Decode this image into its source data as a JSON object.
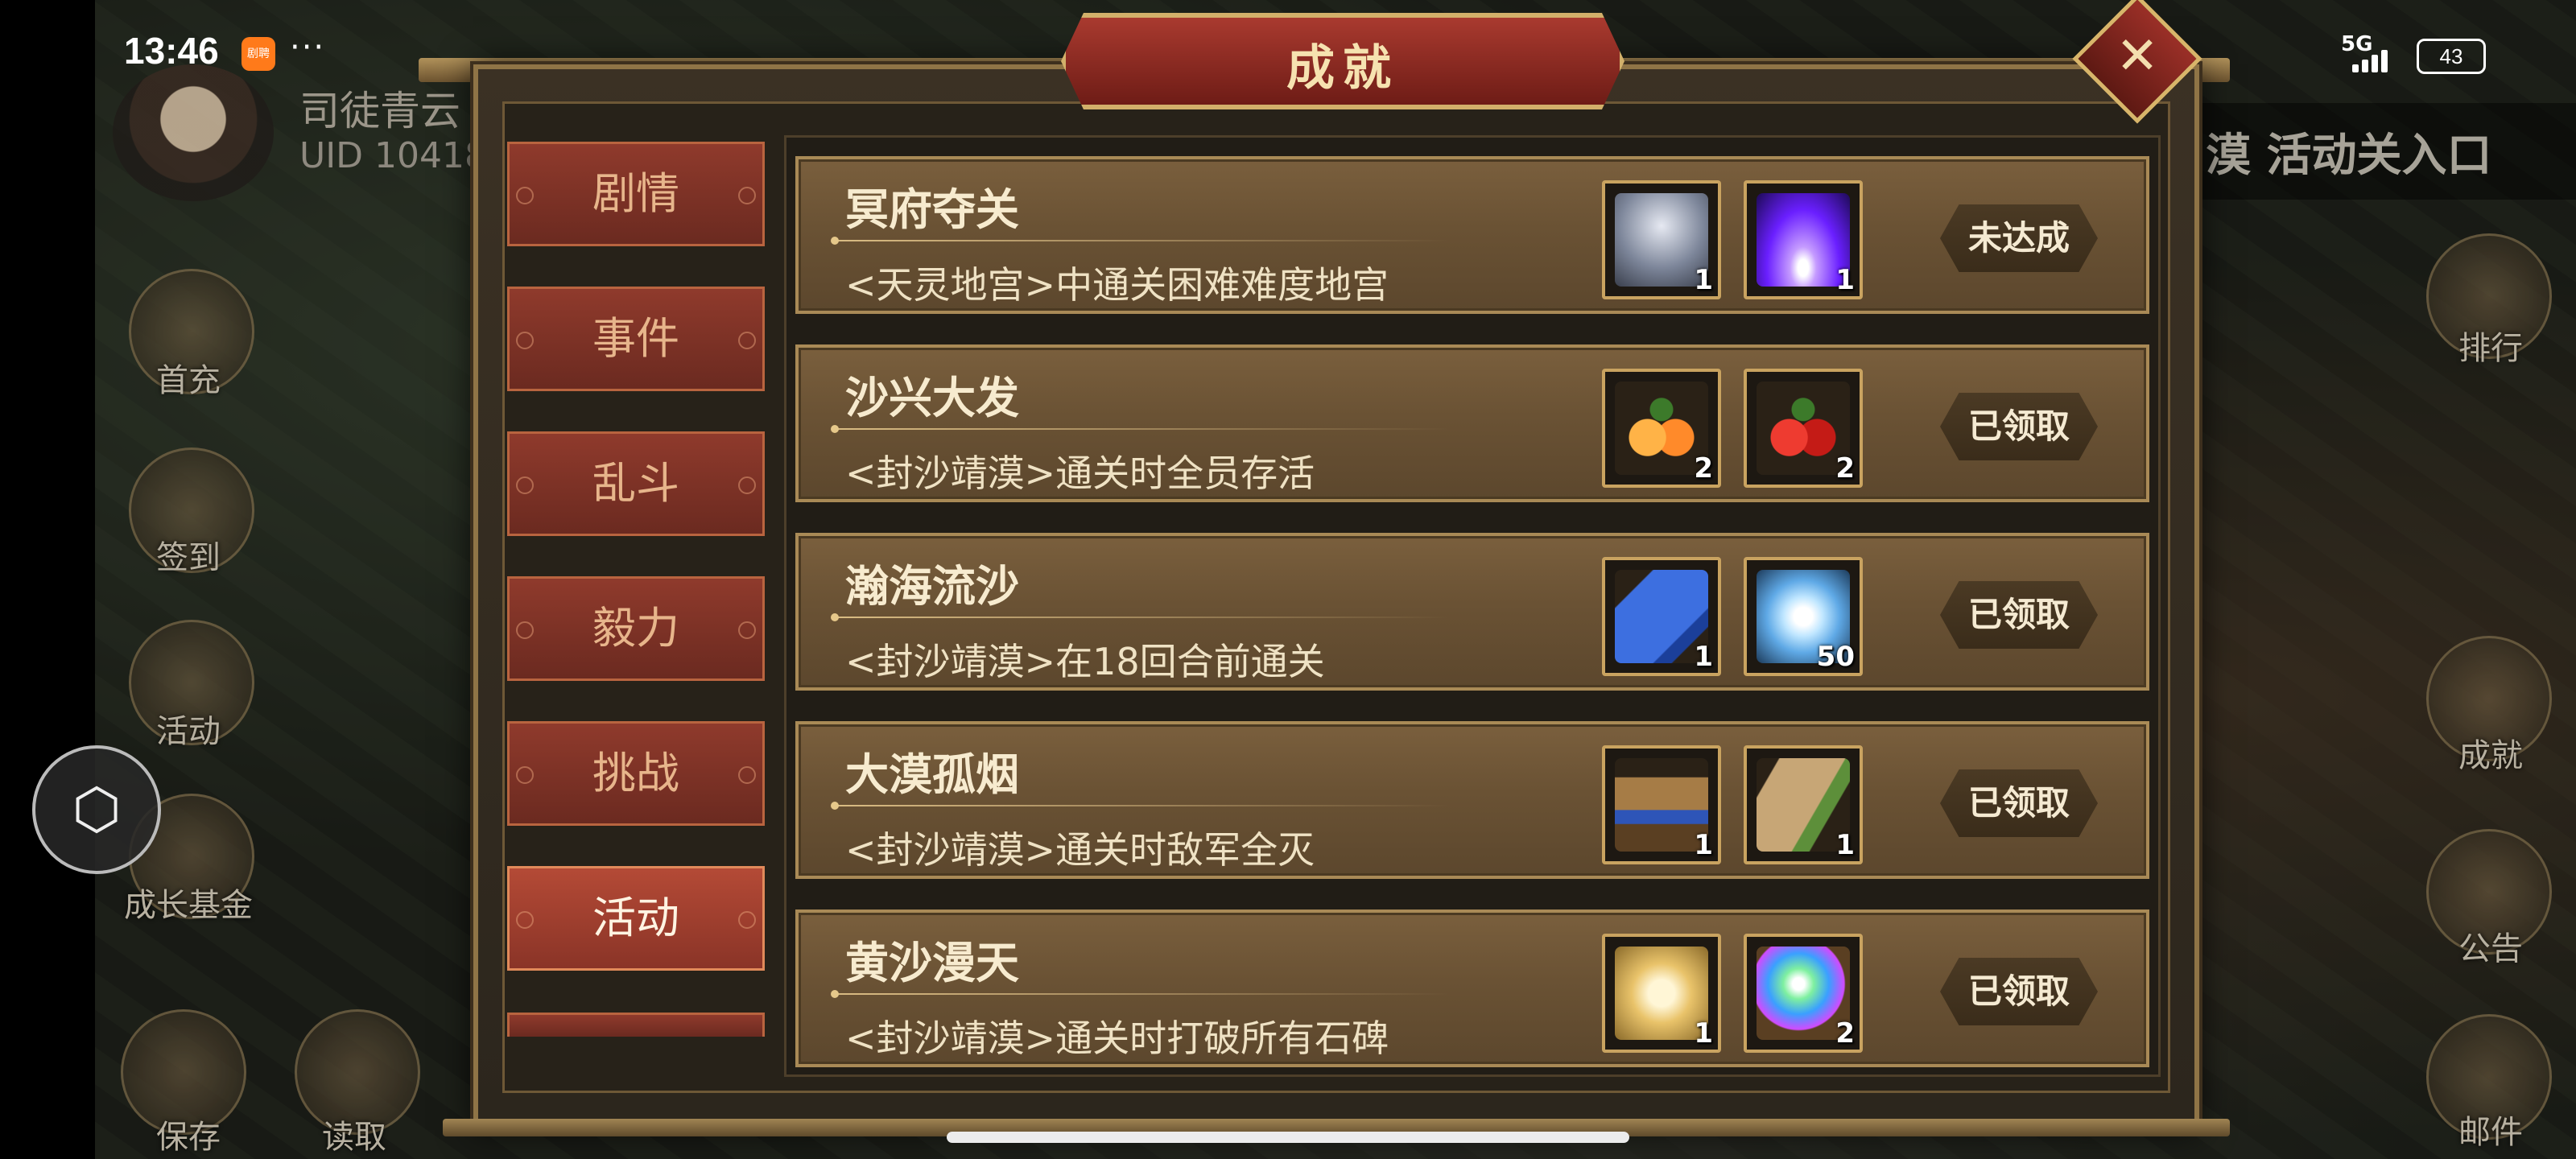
{
  "status_bar": {
    "time": "13:46",
    "app_badge": "剧聘",
    "more": "···",
    "network": "5G",
    "battery": "43"
  },
  "player": {
    "name": "司徒青云",
    "uid": "UID  10418"
  },
  "side_menu_left": [
    {
      "label": "首充",
      "icon": "gift-icon"
    },
    {
      "label": "签到",
      "icon": "scroll-icon"
    },
    {
      "label": "活动",
      "icon": "bag-icon"
    },
    {
      "label": "成长基金",
      "icon": "flower-icon"
    },
    {
      "label": "保存",
      "icon": "save-icon"
    },
    {
      "label": "读取",
      "icon": "load-icon"
    }
  ],
  "side_menu_right": [
    {
      "label": "排行",
      "icon": "leaderboard-icon"
    },
    {
      "label": "成就",
      "icon": "achievement-icon"
    },
    {
      "label": "公告",
      "icon": "notice-icon"
    },
    {
      "label": "邮件",
      "icon": "mail-icon"
    }
  ],
  "scene": {
    "banner": "漠 活动关入口"
  },
  "dialog": {
    "title": "成就",
    "close_icon": "close-icon"
  },
  "tabs": [
    {
      "label": "剧情",
      "active": false
    },
    {
      "label": "事件",
      "active": false
    },
    {
      "label": "乱斗",
      "active": false
    },
    {
      "label": "毅力",
      "active": false
    },
    {
      "label": "挑战",
      "active": false
    },
    {
      "label": "活动",
      "active": true
    }
  ],
  "achievements": [
    {
      "title": "冥府夺关",
      "desc": "<天灵地宫>中通关困难难度地宫",
      "rewards": [
        {
          "icon": "silver-chest-icon",
          "qty": "1",
          "color": "#9aa3b5"
        },
        {
          "icon": "purple-light-icon",
          "qty": "1",
          "color": "#7b3cff"
        }
      ],
      "status": "未达成"
    },
    {
      "title": "沙兴大发",
      "desc": "<封沙靖漠>通关时全员存活",
      "rewards": [
        {
          "icon": "orange-fruit-icon",
          "qty": "2",
          "color": "#ff8a2a"
        },
        {
          "icon": "red-fruit-icon",
          "qty": "2",
          "color": "#d0231e"
        }
      ],
      "status": "已领取"
    },
    {
      "title": "瀚海流沙",
      "desc": "<封沙靖漠>在18回合前通关",
      "rewards": [
        {
          "icon": "blue-scroll-icon",
          "qty": "1",
          "color": "#2a5fc8"
        },
        {
          "icon": "ice-crystal-icon",
          "qty": "50",
          "color": "#bfe6ff"
        }
      ],
      "status": "已领取"
    },
    {
      "title": "大漠孤烟",
      "desc": "<封沙靖漠>通关时敌军全灭",
      "rewards": [
        {
          "icon": "horse-icon",
          "qty": "1",
          "color": "#8a6a3a"
        },
        {
          "icon": "map-scroll-icon",
          "qty": "1",
          "color": "#b99a6a"
        }
      ],
      "status": "已领取"
    },
    {
      "title": "黄沙漫天",
      "desc": "<封沙靖漠>通关时打破所有石碑",
      "rewards": [
        {
          "icon": "gold-card-icon",
          "qty": "1",
          "color": "#e9c36a"
        },
        {
          "icon": "rainbow-orb-icon",
          "qty": "2",
          "color": "#57d67c"
        }
      ],
      "status": "已领取"
    }
  ]
}
